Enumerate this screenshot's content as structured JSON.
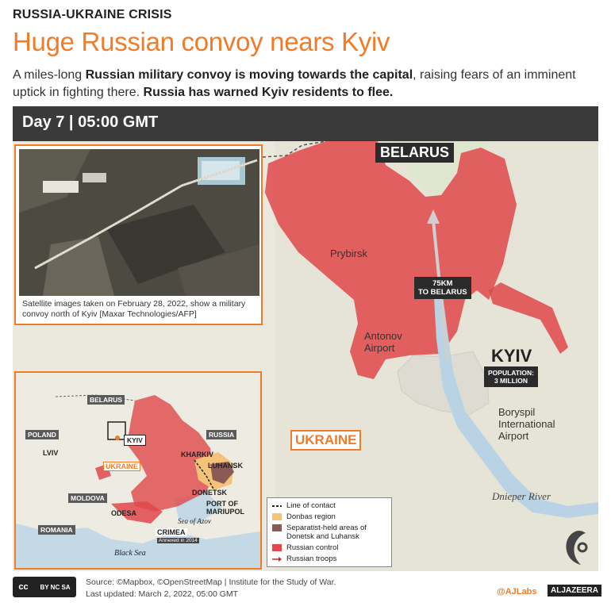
{
  "kicker": "RUSSIA-UKRAINE CRISIS",
  "headline": "Huge Russian convoy nears Kyiv",
  "standfirst": {
    "p1": "A miles-long ",
    "b1": "Russian military convoy is moving towards the capital",
    "p2": ", raising fears of an imminent uptick in fighting there. ",
    "b2": "Russia has warned Kyiv residents to flee."
  },
  "day_bar": "Day 7 | 05:00 GMT",
  "main_map": {
    "belarus": "BELARUS",
    "prybirsk": "Prybirsk",
    "antonov_l1": "Antonov",
    "antonov_l2": "Airport",
    "distance_l1": "75KM",
    "distance_l2": "TO BELARUS",
    "kyiv": "KYIV",
    "population_l1": "POPULATION:",
    "population_l2": "3 MILLION",
    "boryspil_l1": "Boryspil",
    "boryspil_l2": "International",
    "boryspil_l3": "Airport",
    "ukraine": "UKRAINE",
    "river": "Dnieper River",
    "colors": {
      "russian_control": "#e0484b",
      "accent": "#f07c2a",
      "label_bg": "#2b2b2b"
    }
  },
  "photo_caption": "Satellite images taken on February 28, 2022, show a military convoy north of Kyiv [Maxar Technologies/AFP]",
  "inset": {
    "belarus": "BELARUS",
    "russia": "RUSSIA",
    "poland": "POLAND",
    "lviv": "LVIV",
    "kyiv": "KYIV",
    "ukraine": "UKRAINE",
    "kharkiv": "KHARKIV",
    "luhansk": "LUHANSK",
    "donetsk": "DONETSK",
    "port_l1": "PORT OF",
    "port_l2": "MARIUPOL",
    "moldova": "MOLDOVA",
    "odesa": "ODESA",
    "romania": "ROMANIA",
    "crimea": "CRIMEA",
    "annexed": "Annexed in 2014",
    "sea_azov": "Sea of Azov",
    "black_sea": "Black Sea"
  },
  "legend": {
    "items": [
      {
        "label": "Line of contact",
        "color": "#222222"
      },
      {
        "label": "Donbas region",
        "color": "#f5c27a"
      },
      {
        "label": "Separatist-held areas of Donetsk and Luhansk",
        "color": "#8b5a57"
      },
      {
        "label": "Russian control",
        "color": "#e0484b"
      },
      {
        "label": "Russian troops",
        "color": "#c0262b"
      }
    ]
  },
  "footer": {
    "license_cc": "cc",
    "license_tags": "BY NC SA",
    "source": "Source: ©Mapbox, ©OpenStreetMap  |  Institute for the Study of War.",
    "updated": "Last updated: March 2, 2022, 05:00 GMT",
    "handle": "@AJLabs",
    "brand": "ALJAZEERA"
  }
}
